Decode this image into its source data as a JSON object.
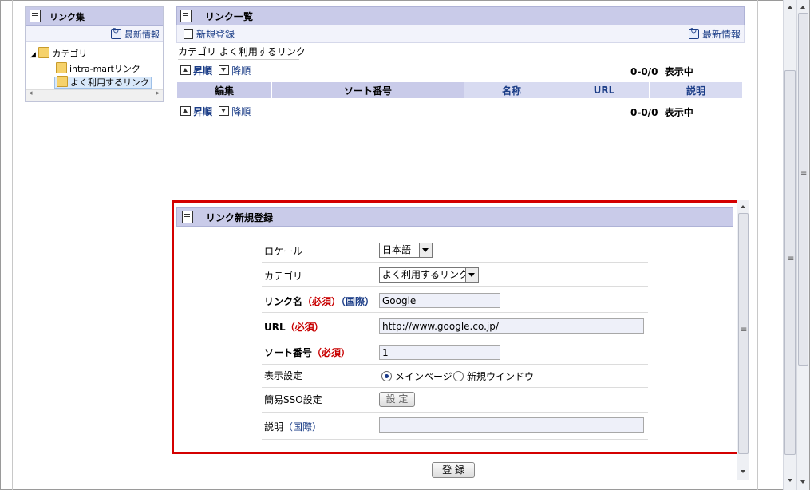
{
  "sidebar": {
    "title": "リンク集",
    "refresh_label": "最新情報",
    "tree": {
      "root": "カテゴリ",
      "children": [
        "intra-martリンク",
        "よく利用するリンク"
      ],
      "selected": "よく利用するリンク"
    }
  },
  "list": {
    "title": "リンク一覧",
    "new_label": "新規登録",
    "refresh_label": "最新情報",
    "category_prefix": "カテゴリ",
    "category_name": "よく利用するリンク",
    "asc_label": "昇順",
    "desc_label": "降順",
    "count_text": "0-0/0",
    "showing_label": "表示中",
    "columns": [
      "編集",
      "ソート番号",
      "名称",
      "URL",
      "説明"
    ]
  },
  "form": {
    "title": "リンク新規登録",
    "locale": {
      "label": "ロケール",
      "value": "日本語"
    },
    "category": {
      "label": "カテゴリ",
      "value": "よく利用するリンク"
    },
    "link_name": {
      "label": "リンク名",
      "required": "（必須）",
      "intl": "（国際）",
      "value": "Google"
    },
    "url": {
      "label": "URL",
      "required": "（必須）",
      "value": "http://www.google.co.jp/"
    },
    "sort": {
      "label": "ソート番号",
      "required": "（必須）",
      "value": "1"
    },
    "display": {
      "label": "表示設定",
      "options": [
        "メインページ",
        "新規ウインドウ"
      ],
      "selected": "メインページ"
    },
    "sso": {
      "label": "簡易SSO設定",
      "button": "設 定"
    },
    "description": {
      "label": "説明",
      "intl": "（国際）",
      "value": ""
    },
    "submit_label": "登 録"
  }
}
